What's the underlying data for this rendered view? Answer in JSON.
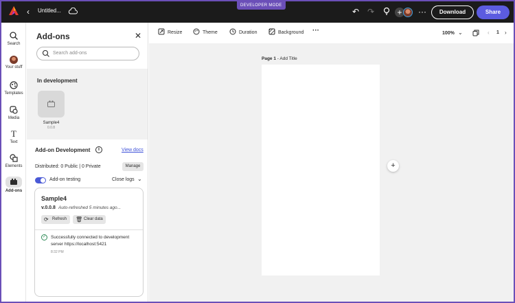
{
  "topbar": {
    "dev_mode": "DEVELOPER MODE",
    "doc_title": "Untitled...",
    "download_label": "Download",
    "share_label": "Share"
  },
  "rail": {
    "items": [
      {
        "label": "Search",
        "icon": "search-icon"
      },
      {
        "label": "Your stuff",
        "icon": "avatar"
      },
      {
        "label": "Templates",
        "icon": "templates-icon"
      },
      {
        "label": "Media",
        "icon": "media-icon"
      },
      {
        "label": "Text",
        "icon": "text-icon"
      },
      {
        "label": "Elements",
        "icon": "elements-icon"
      },
      {
        "label": "Add-ons",
        "icon": "addons-icon",
        "active": true
      }
    ]
  },
  "panel": {
    "title": "Add-ons",
    "search_placeholder": "Search add-ons",
    "in_development": {
      "title": "In development",
      "addon_name": "Sample4",
      "addon_version": "0.0.8"
    },
    "dev": {
      "title": "Add-on Development",
      "view_docs": "View docs",
      "distributed": "Distributed: 0 Public  |  0 Private",
      "manage": "Manage",
      "testing_label": "Add-on testing",
      "testing_enabled": true,
      "close_logs": "Close logs"
    },
    "log": {
      "name": "Sample4",
      "version": "v.0.0.8",
      "refreshed": "Auto-refreshed 5 minutes ago...",
      "refresh_label": "Refresh",
      "clear_label": "Clear data",
      "message": "Successfully connected to development server https://localhost:5421",
      "time": "8:32 PM"
    }
  },
  "toolbar": {
    "resize": "Resize",
    "theme": "Theme",
    "duration": "Duration",
    "background": "Background",
    "zoom": "100%",
    "page_number": "1"
  },
  "canvas": {
    "page_label_bold": "Page 1",
    "page_label_rest": " - Add Title"
  },
  "colors": {
    "accent": "#5c5ce0",
    "dev_badge": "#6b4fb8",
    "topbar": "#1b1b1b",
    "toggle": "#4a5ad6"
  }
}
